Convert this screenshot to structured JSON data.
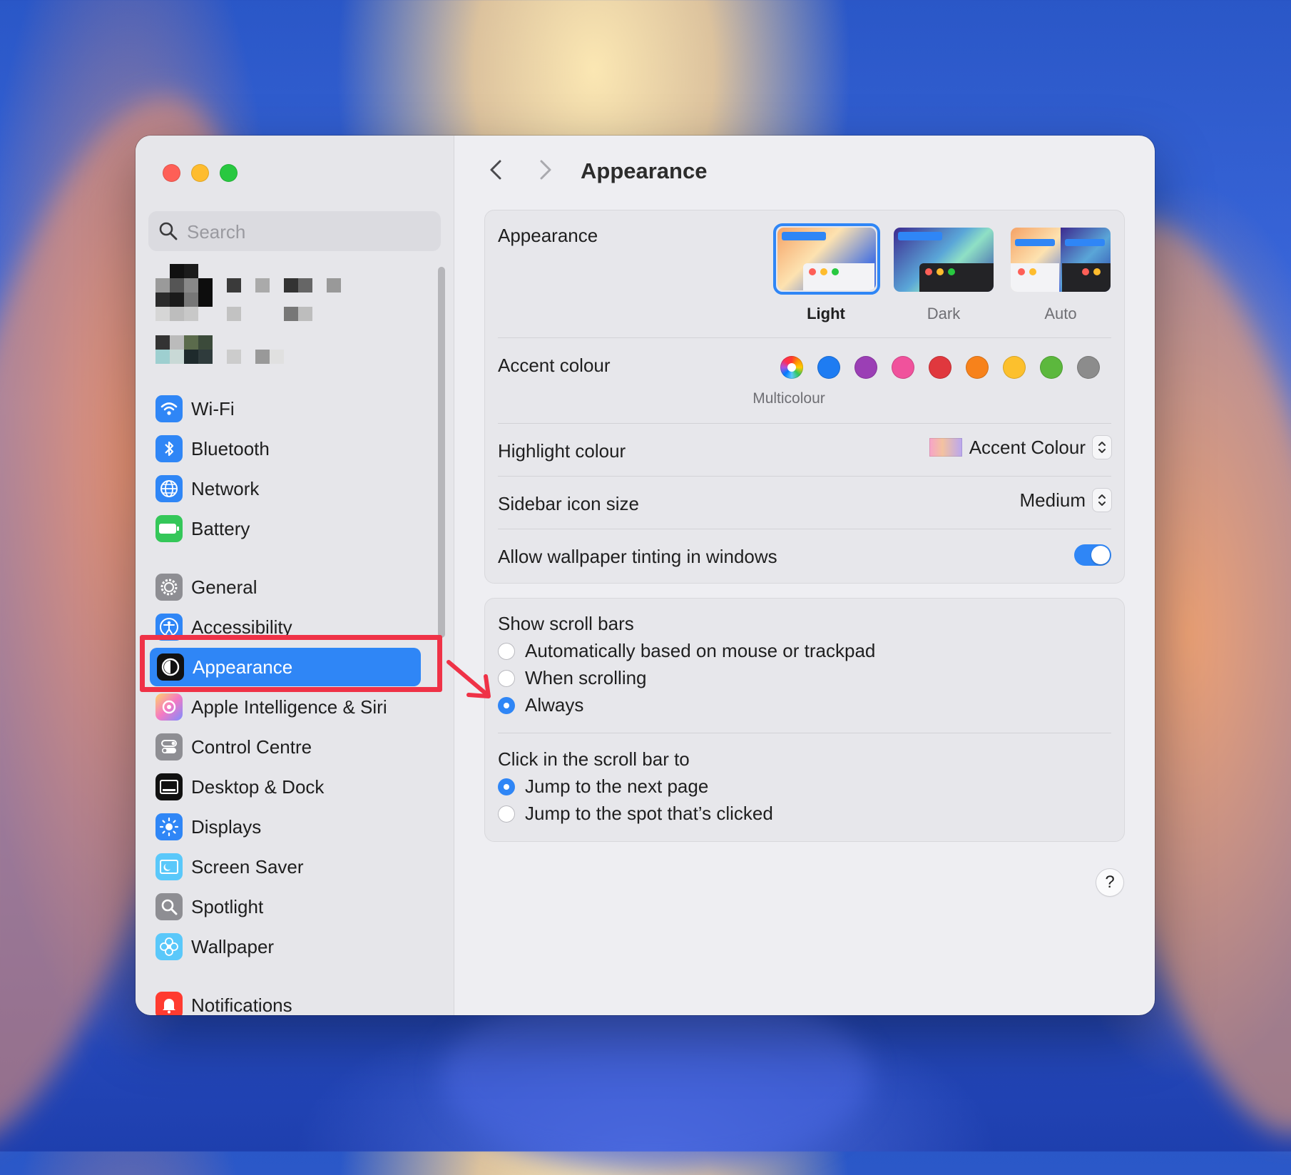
{
  "window": {
    "page_title": "Appearance"
  },
  "search": {
    "placeholder": "Search"
  },
  "sidebar": {
    "items": [
      {
        "label": "Wi-Fi",
        "icon": "wifi-icon",
        "color": "#2f86f6"
      },
      {
        "label": "Bluetooth",
        "icon": "bluetooth-icon",
        "color": "#2f86f6"
      },
      {
        "label": "Network",
        "icon": "globe-icon",
        "color": "#2f86f6"
      },
      {
        "label": "Battery",
        "icon": "battery-icon",
        "color": "#34c759"
      },
      {
        "label": "General",
        "icon": "gear-icon",
        "color": "#8e8e93"
      },
      {
        "label": "Accessibility",
        "icon": "accessibility-icon",
        "color": "#2f86f6"
      },
      {
        "label": "Appearance",
        "icon": "appearance-icon",
        "color": "#111111",
        "selected": true
      },
      {
        "label": "Apple Intelligence & Siri",
        "icon": "siri-icon",
        "color": "#e8a3e0"
      },
      {
        "label": "Control Centre",
        "icon": "control-centre-icon",
        "color": "#8e8e93"
      },
      {
        "label": "Desktop & Dock",
        "icon": "dock-icon",
        "color": "#111111"
      },
      {
        "label": "Displays",
        "icon": "sun-icon",
        "color": "#2f86f6"
      },
      {
        "label": "Screen Saver",
        "icon": "screen-saver-icon",
        "color": "#5ac8fa"
      },
      {
        "label": "Spotlight",
        "icon": "magnifier-icon",
        "color": "#8e8e93"
      },
      {
        "label": "Wallpaper",
        "icon": "flower-icon",
        "color": "#5ac8fa"
      },
      {
        "label": "Notifications",
        "icon": "bell-icon",
        "color": "#ff3b30"
      }
    ]
  },
  "appearance": {
    "label": "Appearance",
    "options": [
      {
        "label": "Light",
        "selected": true
      },
      {
        "label": "Dark",
        "selected": false
      },
      {
        "label": "Auto",
        "selected": false
      }
    ]
  },
  "accent": {
    "label": "Accent colour",
    "selected_caption": "Multicolour",
    "colors": [
      "multicolour",
      "#1e7cf2",
      "#9b3fb5",
      "#f0529c",
      "#e0383e",
      "#f7821b",
      "#fcc02d",
      "#5cb83d",
      "#8c8c8c"
    ]
  },
  "highlight": {
    "label": "Highlight colour",
    "value": "Accent Colour"
  },
  "icon_size": {
    "label": "Sidebar icon size",
    "value": "Medium"
  },
  "tinting": {
    "label": "Allow wallpaper tinting in windows",
    "on": true
  },
  "scroll_bars": {
    "label": "Show scroll bars",
    "options": [
      {
        "label": "Automatically based on mouse or trackpad",
        "selected": false
      },
      {
        "label": "When scrolling",
        "selected": false
      },
      {
        "label": "Always",
        "selected": true
      }
    ]
  },
  "click_scroll": {
    "label": "Click in the scroll bar to",
    "options": [
      {
        "label": "Jump to the next page",
        "selected": true
      },
      {
        "label": "Jump to the spot that’s clicked",
        "selected": false
      }
    ]
  },
  "help": {
    "label": "?"
  }
}
